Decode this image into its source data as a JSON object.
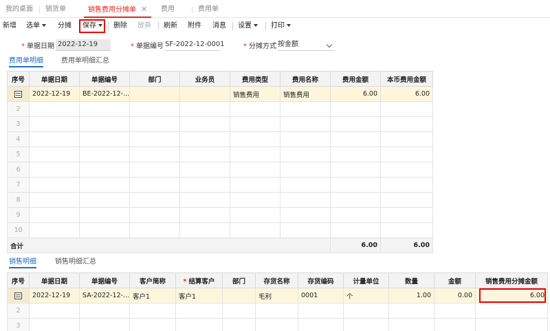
{
  "tabs": [
    {
      "label": "我的桌面"
    },
    {
      "label": "销货单"
    },
    {
      "label": "销售费用分摊单",
      "active": true
    },
    {
      "label": "费用"
    },
    {
      "label": "费用单"
    }
  ],
  "tab_close": "✕",
  "toolbar": {
    "add": "新增",
    "select": "选单",
    "allocate": "分摊",
    "save": "保存",
    "delete": "删除",
    "abandon": "放弃",
    "refresh": "刷新",
    "attachment": "附件",
    "message": "消息",
    "settings": "设置",
    "print": "打印"
  },
  "form": {
    "date_label": "单据日期",
    "date_value": "2022-12-19",
    "number_label": "单据编号",
    "number_value": "SF-2022-12-0001",
    "method_label": "分摊方式",
    "method_value": "按金额"
  },
  "expense_tabs": {
    "detail": "费用单明细",
    "summary": "费用单明细汇总"
  },
  "expense_grid": {
    "headers": [
      "序号",
      "单据日期",
      "单据编号",
      "部门",
      "业务员",
      "费用类型",
      "费用名称",
      "费用金额",
      "本币费用金额"
    ],
    "row1": {
      "date": "2022-12-19",
      "number": "BE-2022-12-...",
      "dept": "",
      "staff": "",
      "type": "销售费用",
      "name": "销售费用",
      "amount": "6.00",
      "local_amount": "6.00"
    },
    "row_numbers": [
      "2",
      "3",
      "4",
      "5",
      "6",
      "7",
      "8",
      "9",
      "10"
    ],
    "total_label": "合计",
    "total_amount": "6.00",
    "total_local_amount": "6.00"
  },
  "sales_tabs": {
    "detail": "销售明细",
    "summary": "销售明细汇总"
  },
  "sales_grid": {
    "headers": [
      "序号",
      "单据日期",
      "单据编号",
      "客户简称",
      "结算客户",
      "部门",
      "存货名称",
      "存货编码",
      "计量单位",
      "数量",
      "金额",
      "销售费用分摊金额"
    ],
    "row1": {
      "date": "2022-12-19",
      "number": "SA-2022-12-...",
      "customer": "客户1",
      "settle_customer": "客户1",
      "dept": "",
      "item_name": "毛利",
      "item_code": "0001",
      "unit": "个",
      "qty": "1.00",
      "amount": "0.00",
      "alloc_amount": "6.00"
    },
    "row_numbers": [
      "2",
      "3"
    ]
  }
}
